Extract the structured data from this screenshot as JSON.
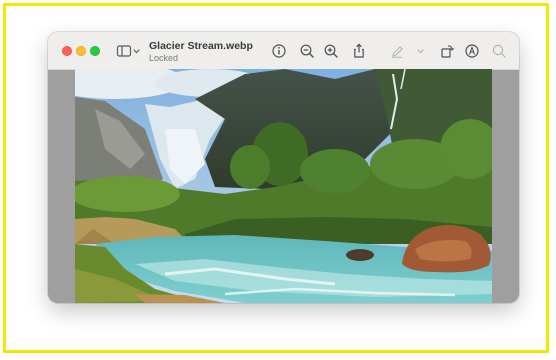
{
  "window": {
    "title": "Glacier Stream.webp",
    "subtitle": "Locked"
  },
  "toolbar": {
    "icons": [
      "sidebar-icon",
      "chevron-down-icon",
      "info-icon",
      "zoom-out-icon",
      "zoom-in-icon",
      "share-icon",
      "markup-pen-icon",
      "chevron-down-icon",
      "rotate-icon",
      "annotate-icon",
      "search-icon"
    ]
  },
  "colors": {
    "close": "#ff5f57",
    "minimize": "#febc2e",
    "zoom": "#28c840",
    "frame": "#f3e600"
  }
}
